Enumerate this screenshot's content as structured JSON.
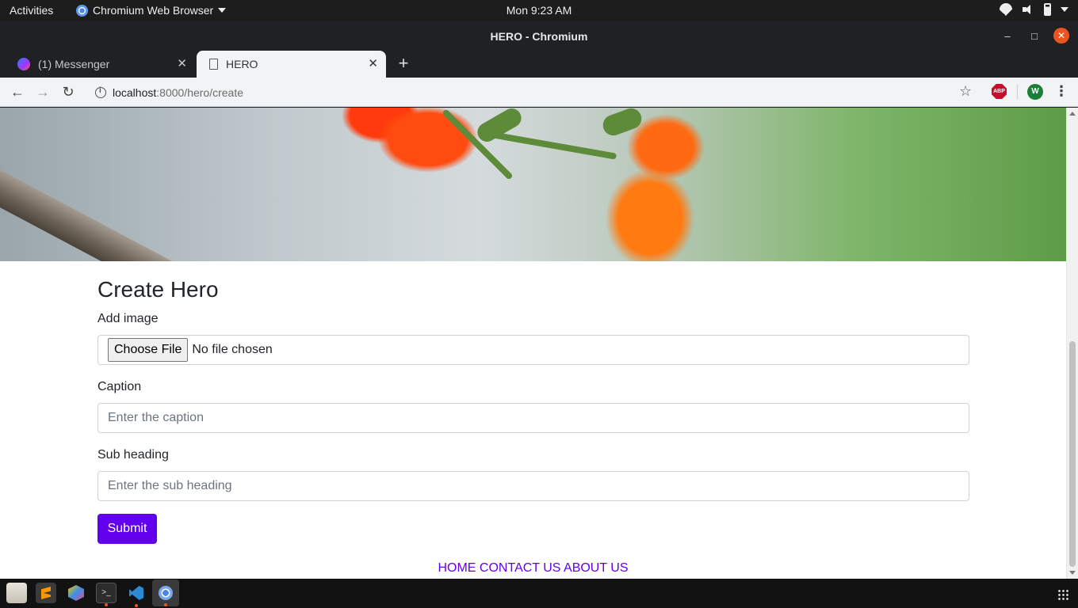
{
  "system": {
    "activities": "Activities",
    "app_name": "Chromium Web Browser",
    "clock": "Mon  9:23 AM"
  },
  "window": {
    "title": "HERO - Chromium"
  },
  "tabs": [
    {
      "label": "(1) Messenger"
    },
    {
      "label": "HERO"
    }
  ],
  "toolbar": {
    "url_host": "localhost",
    "url_rest": ":8000/hero/create",
    "abp_label": "ABP",
    "profile_initial": "W"
  },
  "form": {
    "title": "Create Hero",
    "image_label": "Add image",
    "choose_file_label": "Choose File",
    "no_file_text": "No file chosen",
    "caption_label": "Caption",
    "caption_placeholder": "Enter the caption",
    "subheading_label": "Sub heading",
    "subheading_placeholder": "Enter the sub heading",
    "submit_label": "Submit"
  },
  "footer": {
    "links": [
      "HOME",
      "CONTACT US",
      "ABOUT US"
    ]
  },
  "colors": {
    "accent": "#6200ee",
    "ubuntu_orange": "#e95420"
  }
}
